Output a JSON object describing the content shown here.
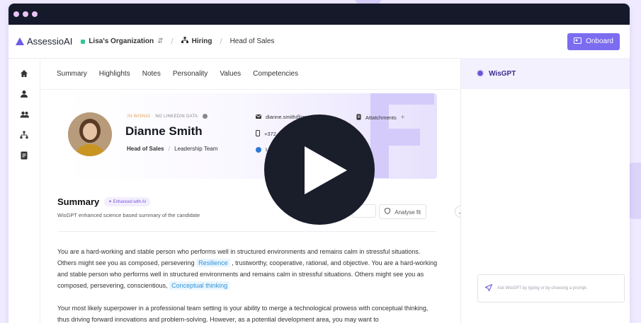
{
  "app": {
    "name": "AssessioAI"
  },
  "breadcrumb": {
    "org": "Lisa's Organization",
    "section": "Hiring",
    "page": "Head of Sales"
  },
  "header": {
    "onboard_label": "Onboard"
  },
  "sidebar": {
    "icons": [
      "home-icon",
      "user-icon",
      "users-icon",
      "hierarchy-icon",
      "document-icon"
    ]
  },
  "tabs": [
    "Summary",
    "Highlights",
    "Notes",
    "Personality",
    "Values",
    "Competencies"
  ],
  "profile": {
    "tag_wisnio": "IN WISNIO",
    "tag_linkedin": "NO LINKEDIN DATA",
    "name": "Dianne Smith",
    "role": "Head of Sales",
    "team": "Leadership Team",
    "email": "dianne.smith@gmail.com",
    "phone": "+372",
    "linkedin": "L",
    "attachments_label": "Attatchments"
  },
  "summary": {
    "title": "Summary",
    "ai_badge": "Enhanced with AI",
    "subtitle": "WisGPT enhanced science based summary of the candidate",
    "analyse_label": "Analyse fit",
    "p1_a": "You are a hard-working and stable person who performs well in structured environments and remains calm in stressful situations. Others might see you as composed, persevering",
    "p1_hl1": "Resilience",
    "p1_b": ", trustworthy, cooperative, rational, and objective. You are a hard-working and stable person who performs well in structured environments and remains calm in stressful situations. Others might see you as composed, persevering, conscientious,",
    "p1_hl2": "Conceptual thinking",
    "p2": "Your most likely superpower in a professional team setting is your ability to merge a technological prowess with conceptual thinking, thus driving forward innovations and problem-solving. However, as a potential development area, you may want to"
  },
  "panel": {
    "title": "WisGPT",
    "ask_placeholder": "Ask WisGPT by typing or by choosing a prompt."
  },
  "colors": {
    "accent": "#7b6cf0",
    "titlebar": "#15192a",
    "highlight": "#2f93d8"
  }
}
